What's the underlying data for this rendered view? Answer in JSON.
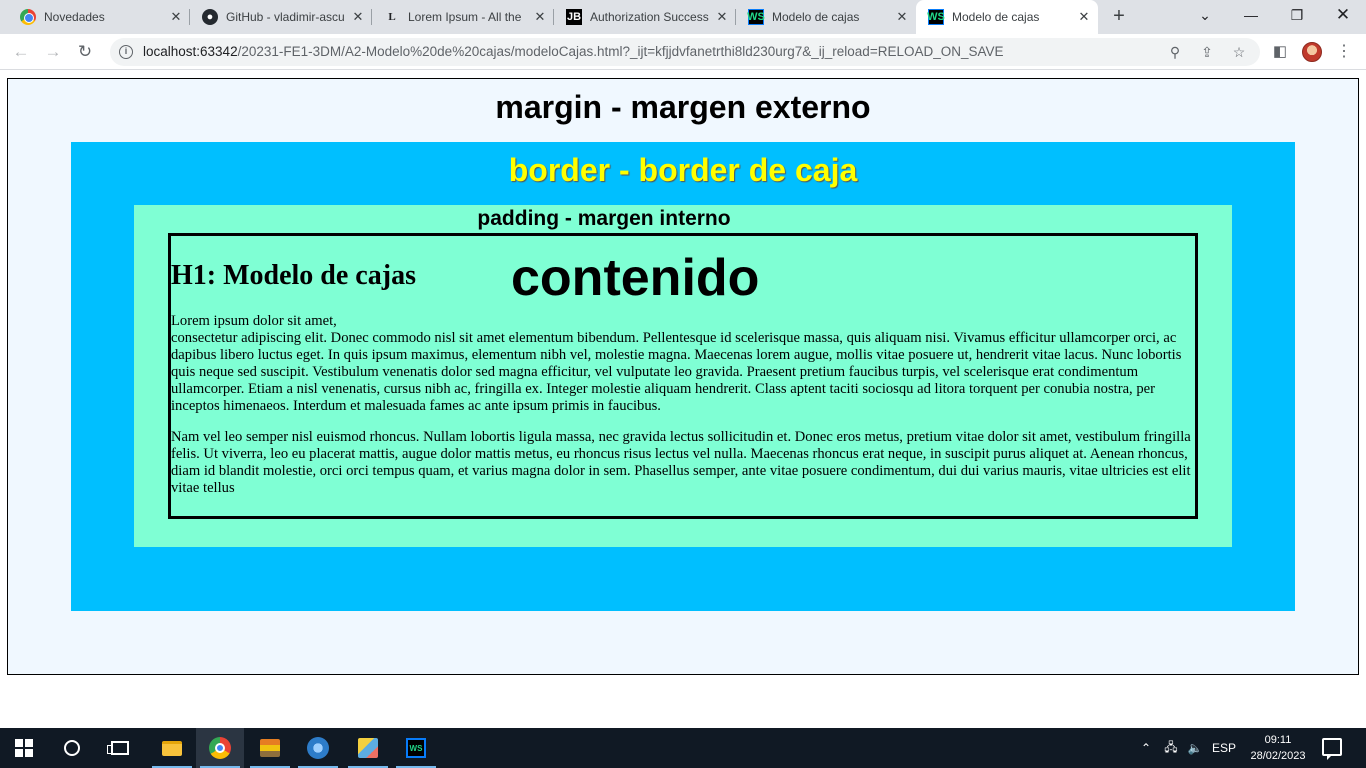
{
  "browser": {
    "tabs": [
      {
        "title": "Novedades",
        "icon": "chrome-icon"
      },
      {
        "title": "GitHub - vladimir-ascu",
        "icon": "github-icon"
      },
      {
        "title": "Lorem Ipsum - All the",
        "icon": "lorem-ipsum-icon"
      },
      {
        "title": "Authorization Success",
        "icon": "jetbrains-icon"
      },
      {
        "title": "Modelo de cajas",
        "icon": "webstorm-icon"
      },
      {
        "title": "Modelo de cajas",
        "icon": "webstorm-icon",
        "active": true
      }
    ],
    "url_host": "localhost:63342",
    "url_rest": "/20231-FE1-3DM/A2-Modelo%20de%20cajas/modeloCajas.html?_ijt=kfjjdvfanetrthi8ld230urg7&_ij_reload=RELOAD_ON_SAVE"
  },
  "page": {
    "margin_title": "margin - margen externo",
    "border_title": "border - border de caja",
    "padding_title": "padding - margen interno",
    "content_title": "contenido",
    "h1": "H1: Modelo de cajas",
    "paragraph1_line1": "Lorem ipsum dolor sit amet,",
    "paragraph1_rest": "consectetur adipiscing elit. Donec commodo nisl sit amet elementum bibendum. Pellentesque id scelerisque massa, quis aliquam nisi. Vivamus efficitur ullamcorper orci, ac dapibus libero luctus eget. In quis ipsum maximus, elementum nibh vel, molestie magna. Maecenas lorem augue, mollis vitae posuere ut, hendrerit vitae lacus. Nunc lobortis quis neque sed suscipit. Vestibulum venenatis dolor sed magna efficitur, vel vulputate leo gravida. Praesent pretium faucibus turpis, vel scelerisque erat condimentum ullamcorper. Etiam a nisl venenatis, cursus nibh ac, fringilla ex. Integer molestie aliquam hendrerit. Class aptent taciti sociosqu ad litora torquent per conubia nostra, per inceptos himenaeos. Interdum et malesuada fames ac ante ipsum primis in faucibus.",
    "paragraph2": "Nam vel leo semper nisl euismod rhoncus. Nullam lobortis ligula massa, nec gravida lectus sollicitudin et. Donec eros metus, pretium vitae dolor sit amet, vestibulum fringilla felis. Ut viverra, leo eu placerat mattis, augue dolor mattis metus, eu rhoncus risus lectus vel nulla. Maecenas rhoncus erat neque, in suscipit purus aliquet at. Aenean rhoncus, diam id blandit molestie, orci orci tempus quam, et varius magna dolor in sem. Phasellus semper, ante vitae posuere condimentum, dui dui varius mauris, vitae ultricies est elit vitae tellus",
    "colors": {
      "margin_bg": "#f0f8ff",
      "border_bg": "#00bfff",
      "border_title": "#ffff00",
      "padding_bg": "#7fffd4"
    }
  },
  "taskbar": {
    "language": "ESP",
    "time": "09:11",
    "date": "28/02/2023"
  }
}
